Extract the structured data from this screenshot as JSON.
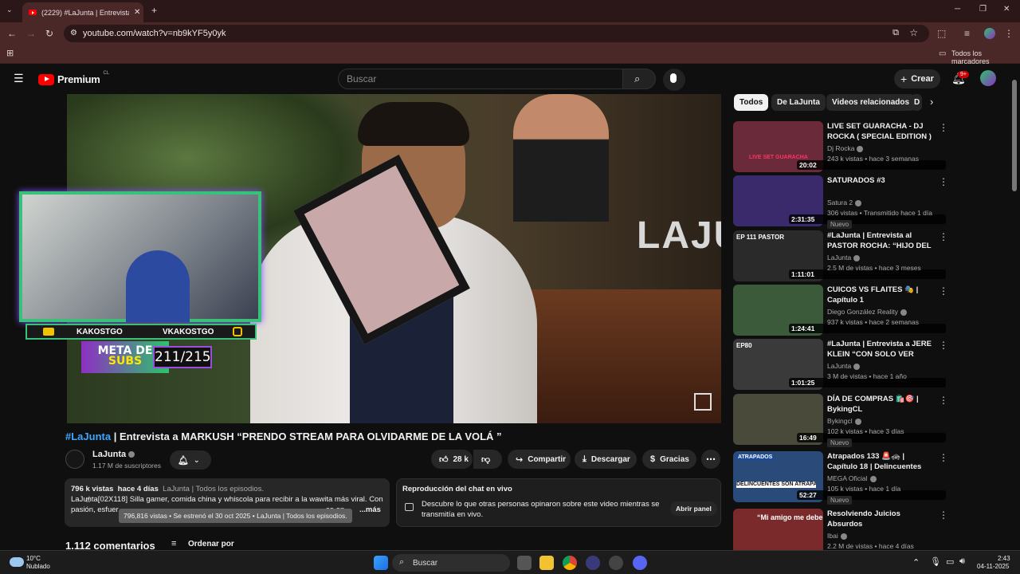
{
  "browser": {
    "tab_title": "(2229) #LaJunta | Entrevista a M",
    "url": "youtube.com/watch?v=nb9kYF5y0yk",
    "bookmarks_label": "Todos los marcadores"
  },
  "header": {
    "logo_text": "Premium",
    "region": "CL",
    "search_placeholder": "Buscar",
    "create_label": "Crear",
    "notif_count": "9+"
  },
  "video": {
    "overlay_left_name": "KAKOSTGO",
    "overlay_right_name": "VKAKOSTGO",
    "meta_line1": "META DE",
    "meta_line2": "SUBS",
    "subs_progress": "211/215",
    "sign_text": "LAJU"
  },
  "title": {
    "tag": "#LaJunta",
    "text": " | Entrevista a MARKUSH “PRENDO STREAM PARA OLVIDARME DE LA VOLÁ ”"
  },
  "channel": {
    "name": "LaJunta",
    "subscribers": "1.17 M de suscriptores"
  },
  "actions": {
    "likes": "28 k",
    "share": "Compartir",
    "download": "Descargar",
    "thanks": "Gracias"
  },
  "description": {
    "views": "796 k vistas",
    "date": "hace 4 días",
    "playlist": "LaJunta | Todos los episodios.",
    "line1": "LaJunta[02X118] Silla gamer, comida china y whiscola para recibir a la wawita más viral. Con",
    "line2_start": "pasión, esfuer",
    "line2_end": "se en",
    "more": "...más",
    "tooltip": "796,816 vistas • Se estrenó el 30 oct 2025 • LaJunta | Todos los episodios."
  },
  "chat": {
    "title": "Reproducción del chat en vivo",
    "text1": "Descubre lo que otras personas opinaron sobre este video mientras se",
    "text2": "transmitía en vivo.",
    "button": "Abrir panel"
  },
  "comments": {
    "count": "1.112 comentarios",
    "sort": "Ordenar por"
  },
  "chips": [
    "Todos",
    "De LaJunta",
    "Videos relacionados",
    "D"
  ],
  "recommendations": [
    {
      "title": "LIVE SET GUARACHA - DJ ROCKA ( SPECIAL EDITION )",
      "channel": "Dj Rocka",
      "meta": "243 k vistas • hace 3 semanas",
      "duration": "20:02",
      "badge": "",
      "thumb": "#6b2a3a"
    },
    {
      "title": "SATURADOS #3",
      "channel": "Satura 2",
      "meta": "306 vistas • Transmitido hace 1 día",
      "duration": "2:31:35",
      "badge": "Nuevo",
      "thumb": "#3a2a6b"
    },
    {
      "title": "#LaJunta | Entrevista al PASTOR ROCHA: “HIJO DEL J...",
      "channel": "LaJunta",
      "meta": "2.5 M de vistas • hace 3 meses",
      "duration": "1:11:01",
      "badge": "",
      "thumb": "#2a2a2a"
    },
    {
      "title": "CUICOS VS FLAITES 🎭 | Capítulo 1",
      "channel": "Diego González Reality",
      "meta": "937 k vistas • hace 2 semanas",
      "duration": "1:24:41",
      "badge": "",
      "thumb": "#3a5a3a"
    },
    {
      "title": "#LaJunta | Entrevista a JERE KLEIN “CON SOLO VER ESTA ...",
      "channel": "LaJunta",
      "meta": "3 M de vistas • hace 1 año",
      "duration": "1:01:25",
      "badge": "",
      "thumb": "#3a3a3a"
    },
    {
      "title": "DÍA DE COMPRAS 🛍️🎯 | BykingCL",
      "channel": "Bykingcl",
      "meta": "102 k vistas • hace 3 días",
      "duration": "16:49",
      "badge": "Nuevo",
      "thumb": "#4a4a3a"
    },
    {
      "title": "Atrapados 133 🚨🚓 | Capítulo 18 | Delincuentes son atrapad...",
      "channel": "MEGA Oficial",
      "meta": "105 k vistas • hace 1 día",
      "duration": "52:27",
      "badge": "Nuevo",
      "thumb": "#2a4a7a"
    },
    {
      "title": "Resolviendo Juicios Absurdos",
      "channel": "Ibai",
      "meta": "2.2 M de vistas • hace 4 días",
      "duration": "",
      "badge": "Nuevo",
      "thumb": "#7a2a2a"
    }
  ],
  "thumb_texts": {
    "t1": "LIVE SET GUARACHA",
    "t3": "EP 111 PASTOR",
    "t5": "EP80",
    "t7a": "ATRAPADOS",
    "t7b": "DELINCUENTES SON ATRAPADOS EN ACCI",
    "t8": "“Mi amigo me debe"
  },
  "taskbar": {
    "temp": "10°C",
    "weather": "Nublado",
    "search": "Buscar",
    "time": "2:43",
    "date": "04-11-2025"
  }
}
